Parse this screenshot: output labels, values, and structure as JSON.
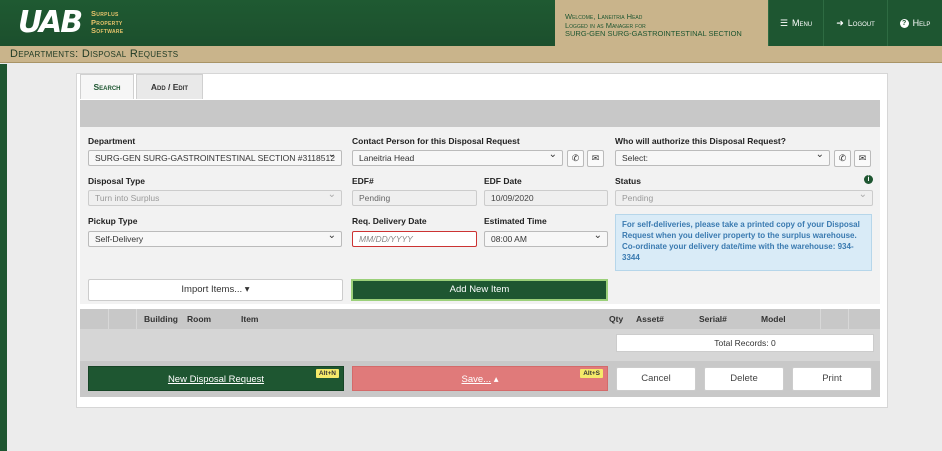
{
  "header": {
    "logo_mark": "UAB",
    "logo_line1": "Surplus",
    "logo_line2": "Property",
    "logo_line3": "Software",
    "welcome_line1": "Welcome, Laneitria Head",
    "welcome_line2": "Logged in as Manager for",
    "welcome_line3": "SURG-GEN SURG-GASTROINTESTINAL SECTION",
    "menu_label": "Menu",
    "logout_label": "Logout",
    "help_label": "Help"
  },
  "page_title": "Departments: Disposal Requests",
  "tabs": [
    {
      "label": "Search"
    },
    {
      "label": "Add / Edit"
    }
  ],
  "form": {
    "department_label": "Department",
    "department_value": "SURG-GEN SURG-GASTROINTESTINAL SECTION #3118512",
    "contact_label": "Contact Person for this Disposal Request",
    "contact_value": "Laneitria Head",
    "authorize_label": "Who will authorize this Disposal Request?",
    "authorize_value": "Select:",
    "disposal_type_label": "Disposal Type",
    "disposal_type_value": "Turn into Surplus",
    "edf_label": "EDF#",
    "edf_value": "Pending",
    "edf_date_label": "EDF Date",
    "edf_date_value": "10/09/2020",
    "status_label": "Status",
    "status_value": "Pending",
    "pickup_type_label": "Pickup Type",
    "pickup_type_value": "Self-Delivery",
    "req_delivery_label": "Req. Delivery Date",
    "req_delivery_placeholder": "MM/DD/YYYY",
    "est_time_label": "Estimated Time",
    "est_time_value": "08:00 AM",
    "notice": "For self-deliveries, please take a printed copy of your Disposal Request when you deliver property to the surplus warehouse. Co-ordinate your delivery date/time with the warehouse: 934-3344"
  },
  "actions": {
    "import_label": "Import Items...",
    "add_new_label": "Add New Item"
  },
  "table": {
    "columns": [
      "Building",
      "Room",
      "Item",
      "Qty",
      "Asset#",
      "Serial#",
      "Model"
    ],
    "total_records": "Total Records: 0"
  },
  "footer": {
    "new_label": "New Disposal Request",
    "new_hotkey": "Alt+N",
    "save_label": "Save...",
    "save_hotkey": "Alt+S",
    "cancel_label": "Cancel",
    "delete_label": "Delete",
    "print_label": "Print"
  }
}
